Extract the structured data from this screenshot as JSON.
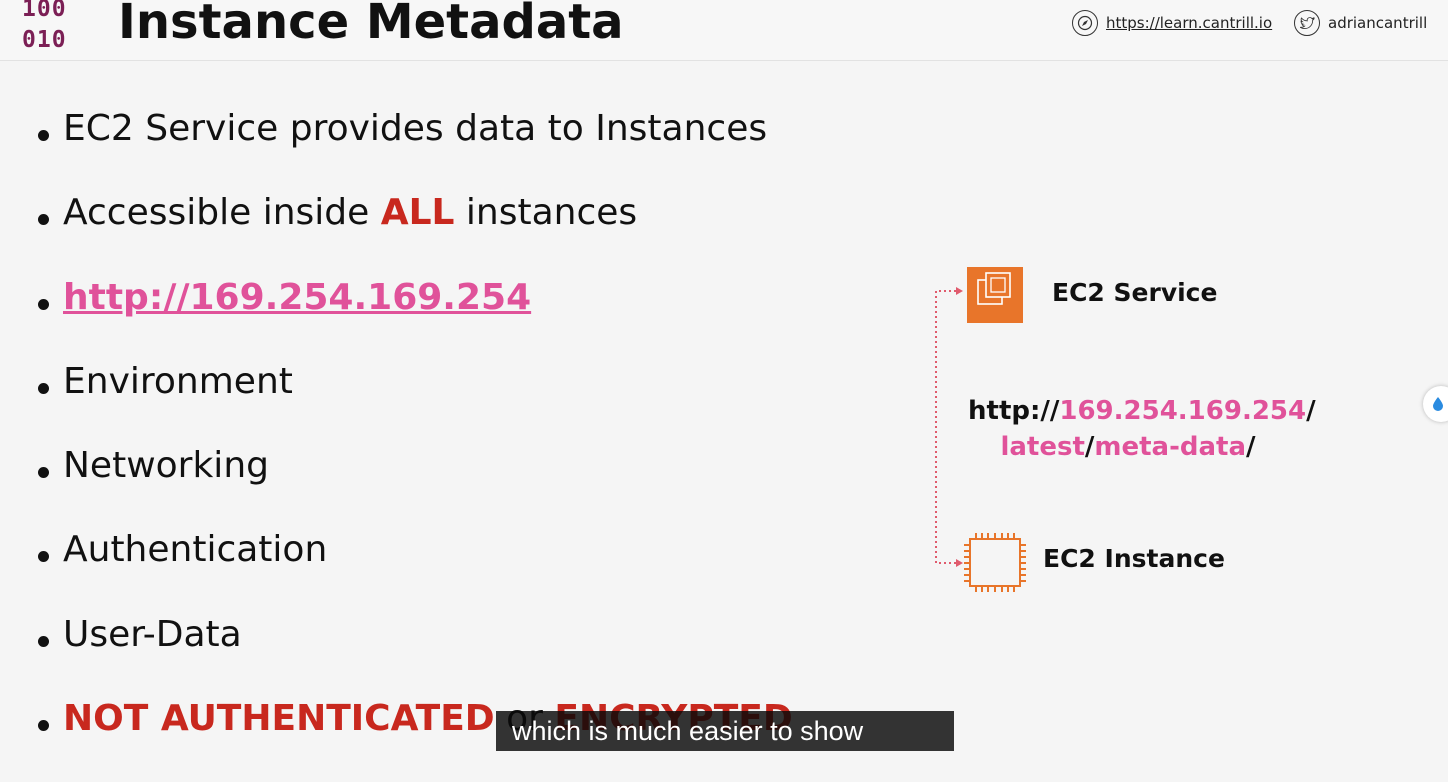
{
  "header": {
    "logo_line1": "100",
    "logo_line2": "010",
    "title": "Instance Metadata",
    "website": "https://learn.cantrill.io",
    "twitter": "adriancantrill"
  },
  "bullets": {
    "b1": "EC2 Service provides data to Instances",
    "b2_prefix": "Accessible inside ",
    "b2_emph": "ALL",
    "b2_suffix": " instances",
    "b3_link": "http://169.254.169.254",
    "b4": "Environment",
    "b5": "Networking",
    "b6": "Authentication",
    "b7": "User-Data",
    "b8_emph": "NOT AUTHENTICATED",
    "b8_mid": " or ",
    "b8_emph2": "ENCRYPTED"
  },
  "diagram": {
    "service_label": "EC2 Service",
    "instance_label": "EC2 Instance",
    "url_prefix": "http://",
    "url_ip": "169.254.169.254",
    "url_slash1": "/",
    "url_latest": "latest",
    "url_slash2": "/",
    "url_meta": "meta-data",
    "url_slash3": "/"
  },
  "caption": {
    "text": "which is much easier to show"
  },
  "colors": {
    "accent_pink": "#e0529a",
    "accent_red": "#c8281e",
    "aws_orange": "#e8752a",
    "logo_maroon": "#7b1f55"
  }
}
